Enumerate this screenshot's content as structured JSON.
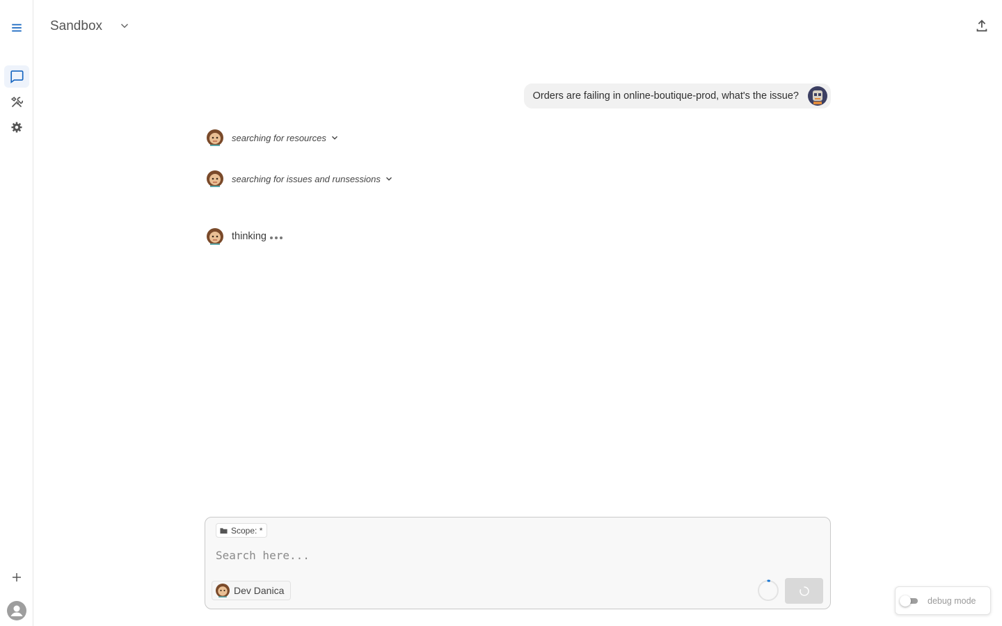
{
  "rail": {
    "items": [
      {
        "name": "menu",
        "icon": "menu-icon"
      },
      {
        "name": "chat",
        "icon": "chat-icon",
        "active": true
      },
      {
        "name": "tools",
        "icon": "tools-icon"
      },
      {
        "name": "settings",
        "icon": "gear-icon"
      },
      {
        "name": "new",
        "icon": "plus-icon"
      },
      {
        "name": "account",
        "icon": "account-icon"
      }
    ],
    "accent": "#1565c0"
  },
  "header": {
    "title": "Sandbox",
    "title_icon": "chevron-down-icon",
    "share_icon": "upload-icon"
  },
  "conversation": {
    "user_message": "Orders are failing in online-boutique-prod, what's the issue?",
    "steps": [
      {
        "label": "searching for resources",
        "expandable": true
      },
      {
        "label": "searching for issues and runsessions",
        "expandable": true
      }
    ],
    "status": "thinking"
  },
  "composer": {
    "scope_label": "Scope: *",
    "scope_icon": "folder-icon",
    "placeholder": "Search here...",
    "value": "",
    "persona": "Dev Danica",
    "send_state": "loading"
  },
  "debug": {
    "label": "debug mode",
    "enabled": false
  }
}
